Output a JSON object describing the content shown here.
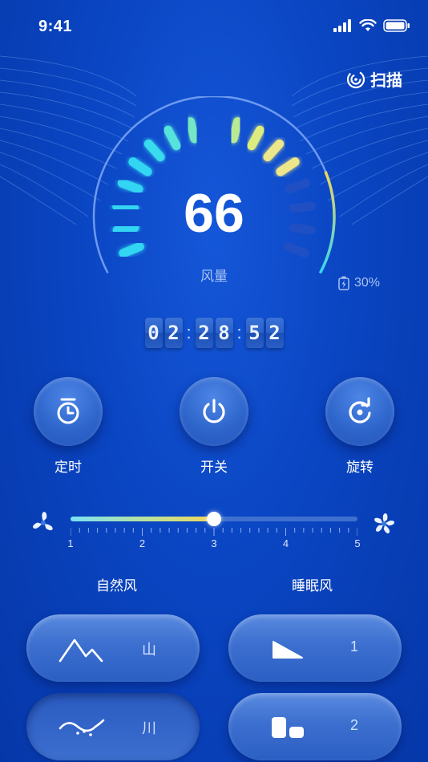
{
  "status": {
    "time": "9:41"
  },
  "header": {
    "scan_label": "扫描"
  },
  "gauge": {
    "value": "66",
    "label": "风量",
    "battery": "30%"
  },
  "timer": {
    "d1": "0",
    "d2": "2",
    "d3": "2",
    "d4": "8",
    "d5": "5",
    "d6": "2"
  },
  "controls": [
    {
      "label": "定时",
      "icon": "timer-icon"
    },
    {
      "label": "开关",
      "icon": "power-icon"
    },
    {
      "label": "旋转",
      "icon": "rotate-icon"
    }
  ],
  "slider": {
    "value": 3,
    "min": 1,
    "max": 5,
    "ticks": [
      "1",
      "2",
      "3",
      "4",
      "5"
    ]
  },
  "modes": {
    "natural_title": "自然风",
    "sleep_title": "睡眠风",
    "natural": [
      {
        "label": "山",
        "icon": "mountain-icon"
      },
      {
        "label": "川",
        "icon": "river-icon"
      }
    ],
    "sleep": [
      {
        "label": "1",
        "icon": "wedge-icon"
      },
      {
        "label": "2",
        "icon": "blocks-icon"
      }
    ]
  },
  "colors": {
    "accent_yellow": "#f3d55c",
    "accent_cyan": "#33d6f2",
    "background": "#0a45c2"
  }
}
